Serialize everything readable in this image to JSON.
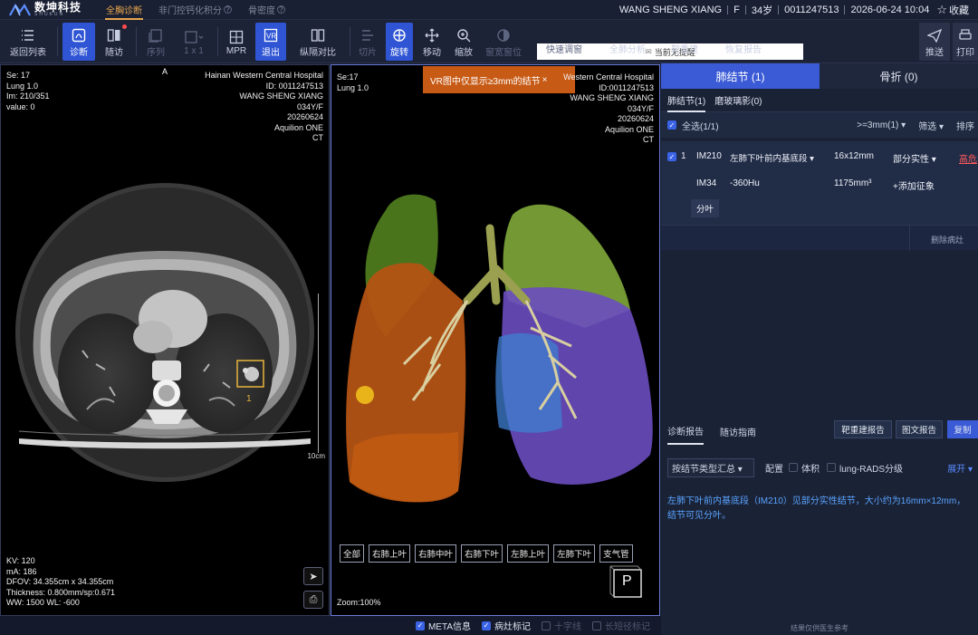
{
  "app": {
    "logo_cn": "数坤科技",
    "logo_en": "SHUKUN",
    "tabs": [
      {
        "label": "全胸诊断",
        "active": true
      },
      {
        "label": "非门控钙化积分",
        "active": false
      },
      {
        "label": "骨密度",
        "active": false
      }
    ]
  },
  "patient": {
    "name": "WANG SHENG XIANG",
    "sex": "F",
    "age": "34岁",
    "id": "0011247513",
    "datetime": "2026-06-24 10:04",
    "favorite_label": "收藏"
  },
  "toolbar": {
    "back": "返回列表",
    "diagnose": "诊断",
    "followup": "随访",
    "series": "序列",
    "layout": "1 x 1",
    "mpr": "MPR",
    "exit": "退出",
    "compare": "纵隔对比",
    "slice": "切片",
    "rotate": "旋转",
    "move": "移动",
    "zoom": "缩放",
    "window": "窗宽窗位",
    "quick_adjust": "快速调窗",
    "lung_analysis": "全肺分析",
    "target_recon": "靶重建",
    "restore_report": "恢复报告",
    "send": "推送",
    "print": "打印",
    "notice": "当前无提醒"
  },
  "left_view": {
    "tl": [
      "Se: 17",
      "Lung 1.0",
      "Im: 210/351",
      "value: 0"
    ],
    "tr": [
      "Hainan Western Central Hospital",
      "ID: 0011247513",
      "WANG SHENG XIANG",
      "034Y/F",
      "20260624",
      "Aquilion ONE",
      "CT"
    ],
    "orientation": "A",
    "bl": [
      "KV: 120",
      "mA: 186",
      "DFOV: 34.355cm x 34.355cm",
      "Thickness: 0.800mm/sp:0.671",
      "WW:  1500    WL:  -600"
    ],
    "ruler_label": "10cm",
    "marker_label": "1"
  },
  "vr_view": {
    "banner": "VR图中仅显示≥3mm的结节",
    "banner_close": "×",
    "tl": [
      "Se:17",
      "Lung 1.0"
    ],
    "tr": [
      "Western Central Hospital",
      "ID:0011247513",
      "WANG SHENG XIANG",
      "034Y/F",
      "20260624",
      "Aquilion ONE",
      "CT"
    ],
    "segments": [
      "全部",
      "右肺上叶",
      "右肺中叶",
      "右肺下叶",
      "左肺上叶",
      "左肺下叶",
      "支气管"
    ],
    "orientation_cube": "P",
    "zoom": "Zoom:100%"
  },
  "bottom_bar": {
    "meta": "META信息",
    "lesion_mark": "病灶标记",
    "crosshair": "十字线",
    "long_short_axis": "长短径标记"
  },
  "right_panel": {
    "tabs": [
      "肺结节 (1)",
      "骨折 (0)"
    ],
    "subtabs": [
      "肺结节(1)",
      "磨玻璃影(0)"
    ],
    "select_all": "全选(1/1)",
    "size_filter": ">=3mm(1)",
    "filter": "筛选",
    "sort": "排序",
    "nodule": {
      "index": "1",
      "image": "IM210",
      "location": "左肺下叶前内基底段",
      "size": "16x12mm",
      "type": "部分实性",
      "risk": "高危",
      "image2": "IM34",
      "density": "-360Hu",
      "volume": "1175mm³",
      "add_sign": "+添加征象",
      "tag": "分叶"
    },
    "delete_lesion": "删除病灶",
    "report_tabs": [
      "诊断报告",
      "随访指南"
    ],
    "report_buttons": [
      "靶重建报告",
      "图文报告",
      "复制"
    ],
    "summary_select": "按结节类型汇总",
    "config": "配置",
    "volume_opt": "体积",
    "lungrads": "lung-RADS分级",
    "expand": "展开",
    "report_line1": "左肺下叶前内基底段（IM210）见部分实性结节，大小约为16mm×12mm，",
    "report_line2": "结节可见分叶。",
    "footnote": "结果仅供医生参考"
  },
  "colors": {
    "accent_blue": "#3b5bd6",
    "active_orange": "#e8a64c",
    "vr_banner": "#c75b16",
    "risk_red": "#ff5a5a",
    "report_text": "#5aa4ff"
  }
}
